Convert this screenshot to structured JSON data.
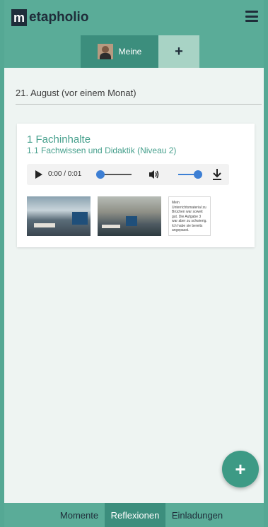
{
  "header": {
    "logo_letter": "m",
    "logo_text": "etapholio",
    "menu_icon": "hamburger-icon"
  },
  "tabs": {
    "meine_label": "Meine",
    "plus_label": "+"
  },
  "date_heading": "21. August (vor einem Monat)",
  "card": {
    "title": "1 Fachinhalte",
    "subtitle": "1.1 Fachwissen und Didaktik (Niveau 2)",
    "audio": {
      "time": "0:00 / 0:01",
      "progress": 0,
      "volume": 1.0
    },
    "note_text": "Mein Unterrichtsmaterial zu Brüchen war soweit gut. Die Aufgabe 3 war aber zu schwierig. Ich habe sie bereits angepasst."
  },
  "fab_label": "+",
  "bottom_nav": {
    "items": [
      {
        "label": "Momente"
      },
      {
        "label": "Reflexionen"
      },
      {
        "label": "Einladungen"
      }
    ],
    "active": "Reflexionen"
  },
  "colors": {
    "primary": "#5aac98",
    "primary_dark": "#3c8e7d",
    "accent_text": "#47a08d",
    "slider_blue": "#3d7fd4"
  }
}
